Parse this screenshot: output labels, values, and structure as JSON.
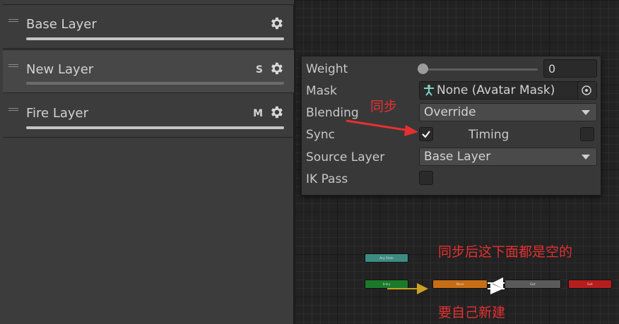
{
  "layers": [
    {
      "name": "Base Layer",
      "badge": ""
    },
    {
      "name": "New Layer",
      "badge": "S"
    },
    {
      "name": "Fire Layer",
      "badge": "M"
    }
  ],
  "settings": {
    "weight_label": "Weight",
    "weight_value": "0",
    "weight_fraction": 0,
    "mask_label": "Mask",
    "mask_value": "None (Avatar Mask)",
    "blending_label": "Blending",
    "blending_value": "Override",
    "sync_label": "Sync",
    "sync_checked": true,
    "timing_label": "Timing",
    "timing_checked": false,
    "source_layer_label": "Source Layer",
    "source_layer_value": "Base Layer",
    "ik_pass_label": "IK Pass",
    "ik_pass_checked": false
  },
  "graph": {
    "nodes": [
      {
        "label": "Any State",
        "color": "#3d8c82"
      },
      {
        "label": "Entry",
        "color": "#1b7a2a"
      },
      {
        "label": "Move",
        "color": "#c76d16"
      },
      {
        "label": "Exit",
        "color": "#5a5a5a"
      },
      {
        "label": "Exit",
        "color": "#b81d1d"
      }
    ]
  },
  "annotations": {
    "sync_note": "同步",
    "empty_note": "同步后这下面都是空的",
    "create_note": "要自己新建"
  },
  "colors": {
    "annotation": "#e63030",
    "panel": "#3c3c3c",
    "popup": "#383838"
  }
}
